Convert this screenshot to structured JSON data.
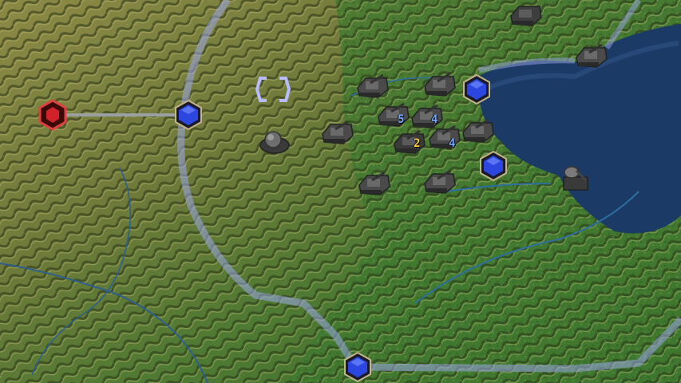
{
  "map": {
    "name": "tactical-map",
    "colors": {
      "lake": "#1c3a66",
      "frontline": "#9aa6e6",
      "allied_node": "#2b47e0",
      "enemy_node": "#d0222a",
      "supply_line": "#9aa0a0"
    }
  },
  "nodes": [
    {
      "id": "enemy-base-west",
      "faction": "enemy",
      "icon": "hex-red-icon"
    },
    {
      "id": "allied-node-west",
      "faction": "allied",
      "icon": "hex-blue-icon"
    },
    {
      "id": "allied-node-lake-north",
      "faction": "allied",
      "icon": "hex-blue-icon"
    },
    {
      "id": "allied-node-lake-south",
      "faction": "allied",
      "icon": "hex-blue-icon"
    },
    {
      "id": "allied-node-south",
      "faction": "allied",
      "icon": "hex-blue-icon"
    }
  ],
  "unit_counts": [
    {
      "id": "stack-a",
      "value": "5",
      "color": "#6fa8ff"
    },
    {
      "id": "stack-b",
      "value": "4",
      "color": "#6fa8ff"
    },
    {
      "id": "stack-c",
      "value": "2",
      "color": "#ffd23a"
    },
    {
      "id": "stack-d",
      "value": "4",
      "color": "#6fa8ff"
    }
  ],
  "cursor": {
    "icon": "selection-bracket-icon"
  }
}
